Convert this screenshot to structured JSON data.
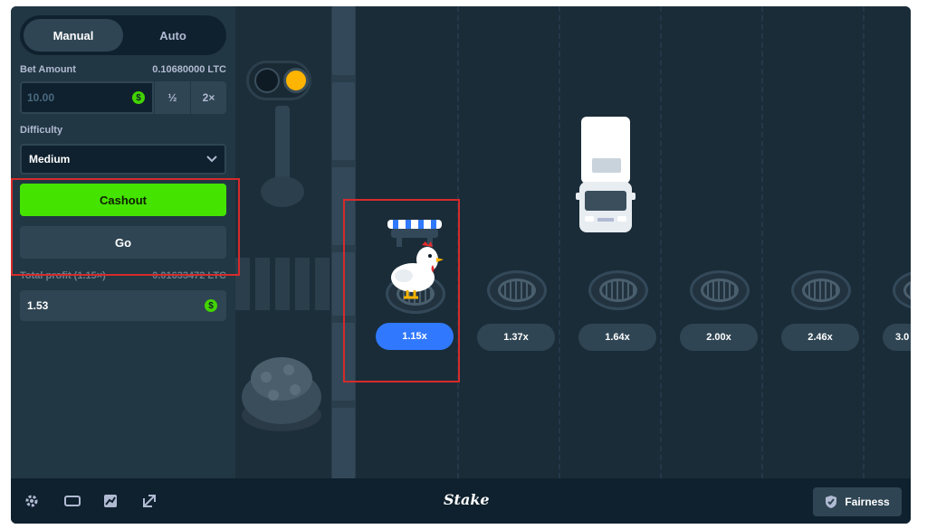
{
  "mode_tabs": [
    {
      "label": "Manual",
      "active": true
    },
    {
      "label": "Auto",
      "active": false
    }
  ],
  "bet": {
    "label": "Bet Amount",
    "value_ltc": "0.10680000 LTC",
    "input_value": "10.00",
    "half_label": "½",
    "double_label": "2×",
    "currency_icon": "dollar-coin-icon"
  },
  "difficulty": {
    "label": "Difficulty",
    "selected": "Medium"
  },
  "actions": {
    "cashout_label": "Cashout",
    "go_label": "Go"
  },
  "profit": {
    "label": "Total profit (1.15×)",
    "value_ltc": "0.01633472 LTC",
    "value": "1.53"
  },
  "lanes": {
    "multipliers": [
      "1.15x",
      "1.37x",
      "1.64x",
      "2.00x",
      "2.46x",
      "3.0"
    ],
    "active_index": 0
  },
  "bottom_bar": {
    "icons": [
      "settings-icon",
      "theater-mode-icon",
      "stats-icon",
      "popout-icon"
    ],
    "brand": "Stake",
    "fairness_label": "Fairness"
  },
  "colors": {
    "accent_green": "#44e300",
    "active_blue": "#3079ff",
    "highlight_red": "#d52b2b"
  }
}
